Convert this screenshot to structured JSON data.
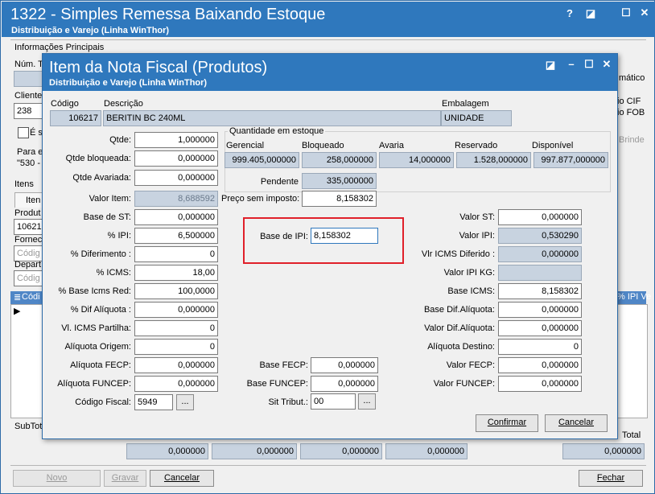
{
  "outer": {
    "title": "1322 - Simples Remessa Baixando Estoque",
    "subtitle": "Distribuição e Varejo (Linha WinThor)",
    "section": "Informações Principais",
    "num_label": "Núm. T",
    "cliente_label": "Cliente",
    "cliente_value": "238",
    "check_label": "É s",
    "para_label": "Para e",
    "para_value": "\"530 -",
    "itens_label": "Itens",
    "item_tab": "Iten",
    "produto_label": "Produt",
    "produto_value": "10621",
    "fornec_label": "Fornec",
    "fornec_placeholder": "Códig",
    "depart_label": "Depart",
    "depart_placeholder": "Códig",
    "grid_col_codigo": "Códi",
    "grid_col_ipi": "% IPI Ve",
    "right_matico": "mático",
    "right_cif": "io CIF",
    "right_fob": "io FOB",
    "right_brinde": "Brinde",
    "subtotal_label": "SubTot",
    "total_label": "Total",
    "subtotals": [
      "0,000000",
      "0,000000",
      "0,000000",
      "0,000000",
      "0,000000"
    ],
    "btn_novo": "Novo",
    "btn_gravar": "Gravar",
    "btn_cancelar": "Cancelar",
    "btn_fechar": "Fechar"
  },
  "dialog": {
    "title": "Item da Nota Fiscal (Produtos)",
    "subtitle": "Distribuição e Varejo (Linha WinThor)",
    "codigo_label": "Código",
    "codigo": "106217",
    "descricao_label": "Descrição",
    "descricao": "BERITIN BC 240ML",
    "embalagem_label": "Embalagem",
    "embalagem": "UNIDADE",
    "left_fields": [
      {
        "label": "Qtde:",
        "value": "1,000000"
      },
      {
        "label": "Qtde bloqueada:",
        "value": "0,000000"
      },
      {
        "label": "Qtde Avariada:",
        "value": "0,000000"
      },
      {
        "label": "Valor Item:",
        "value": "8,688592"
      },
      {
        "label": "Base de ST:",
        "value": "0,000000"
      },
      {
        "label": "% IPI:",
        "value": "6,500000"
      },
      {
        "label": "% Diferimento :",
        "value": "0"
      },
      {
        "label": "% ICMS:",
        "value": "18,00"
      },
      {
        "label": "% Base Icms Red:",
        "value": "100,0000"
      },
      {
        "label": "% Dif Alíquota :",
        "value": "0,000000"
      },
      {
        "label": "Vl. ICMS Partilha:",
        "value": "0"
      },
      {
        "label": "Alíquota Origem:",
        "value": "0"
      },
      {
        "label": "Alíquota FECP:",
        "value": "0,000000"
      },
      {
        "label": "Alíquota FUNCEP:",
        "value": "0,000000"
      }
    ],
    "codigo_fiscal_label": "Código Fiscal:",
    "codigo_fiscal": "5949",
    "estoque": {
      "group_label": "Quantidade em estoque",
      "headers": [
        "Gerencial",
        "Bloqueado",
        "Avaria",
        "Reservado",
        "Disponível"
      ],
      "values": [
        "999.405,000000",
        "258,000000",
        "14,000000",
        "1.528,000000",
        "997.877,000000"
      ],
      "pendente_label": "Pendente",
      "pendente": "335,000000",
      "preco_label": "Preço sem imposto:",
      "preco": "8,158302"
    },
    "base_ipi_label": "Base de IPI:",
    "base_ipi": "8,158302",
    "base_fecp_label": "Base FECP:",
    "base_fecp": "0,000000",
    "base_funcep_label": "Base FUNCEP:",
    "base_funcep": "0,000000",
    "sit_trib_label": "Sit Tribut.:",
    "sit_trib": "00",
    "right_fields": [
      {
        "label": "Valor ST:",
        "value": "0,000000"
      },
      {
        "label": "Valor IPI:",
        "value": "0,530290"
      },
      {
        "label": "Vlr ICMS Diferido :",
        "value": "0,000000"
      },
      {
        "label": "Valor IPI KG:",
        "value": ""
      },
      {
        "label": "Base ICMS:",
        "value": "8,158302"
      },
      {
        "label": "Base Dif.Alíquota:",
        "value": "0,000000"
      },
      {
        "label": "Valor Dif.Alíquota:",
        "value": "0,000000"
      },
      {
        "label": "Alíquota Destino:",
        "value": "0"
      },
      {
        "label": "Valor FECP:",
        "value": "0,000000"
      },
      {
        "label": "Valor FUNCEP:",
        "value": "0,000000"
      }
    ],
    "btn_confirmar": "Confirmar",
    "btn_cancelar": "Cancelar",
    "ellipsis": "..."
  }
}
